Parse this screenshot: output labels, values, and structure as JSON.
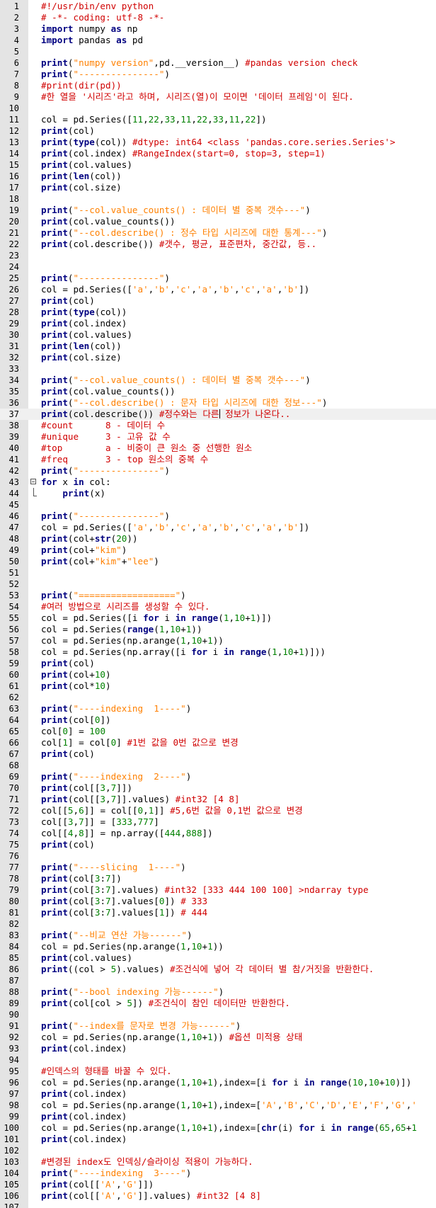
{
  "editor": {
    "current_line": 37,
    "caret_line": 37,
    "caret_column": 30,
    "fold_start_line": 43,
    "fold_end_line": 44,
    "colors": {
      "gutter": "#e4e4e4",
      "keyword": "#000080",
      "string": "#ff8000",
      "number": "#008000",
      "comment": "#d00000"
    },
    "keywords": [
      "import",
      "as",
      "for",
      "in"
    ],
    "builtins": [
      "print",
      "type",
      "len",
      "str",
      "range",
      "chr"
    ],
    "lines": [
      "#!/usr/bin/env python",
      "# -*- coding: utf-8 -*-",
      "import numpy as np",
      "import pandas as pd",
      "",
      "print(\"numpy version\",pd.__version__) #pandas version check",
      "print(\"---------------\")",
      "#print(dir(pd))",
      "#한 열을 '시리즈'라고 하며, 시리즈(열)이 모이면 '데이터 프레임'이 된다.",
      "",
      "col = pd.Series([11,22,33,11,22,33,11,22])",
      "print(col)",
      "print(type(col)) #dtype: int64 <class 'pandas.core.series.Series'>",
      "print(col.index) #RangeIndex(start=0, stop=3, step=1)",
      "print(col.values)",
      "print(len(col))",
      "print(col.size)",
      "",
      "print(\"--col.value_counts() : 데이터 별 중복 갯수---\")",
      "print(col.value_counts())",
      "print(\"--col.describe() : 정수 타입 시리즈에 대한 통계---\")",
      "print(col.describe()) #갯수, 평균, 표준편차, 중간값, 등..",
      "",
      "",
      "print(\"---------------\")",
      "col = pd.Series(['a','b','c','a','b','c','a','b'])",
      "print(col)",
      "print(type(col))",
      "print(col.index)",
      "print(col.values)",
      "print(len(col))",
      "print(col.size)",
      "",
      "print(\"--col.value_counts() : 데이터 별 중복 갯수---\")",
      "print(col.value_counts())",
      "print(\"--col.describe() : 문자 타입 시리즈에 대한 정보---\")",
      "print(col.describe()) #정수와는 다른 정보가 나온다..",
      "#count      8 - 데이터 수",
      "#unique     3 - 고유 값 수",
      "#top        a - 비중이 큰 원소 중 선행한 원소",
      "#freq       3 - top 원소의 중복 수",
      "print(\"---------------\")",
      "for x in col:",
      "    print(x)",
      "",
      "print(\"---------------\")",
      "col = pd.Series(['a','b','c','a','b','c','a','b'])",
      "print(col+str(20))",
      "print(col+\"kim\")",
      "print(col+\"kim\"+\"lee\")",
      "",
      "",
      "print(\"==================\")",
      "#여러 방법으로 시리즈를 생성할 수 있다.",
      "col = pd.Series([i for i in range(1,10+1)])",
      "col = pd.Series(range(1,10+1))",
      "col = pd.Series(np.arange(1,10+1))",
      "col = pd.Series(np.array([i for i in range(1,10+1)]))",
      "print(col)",
      "print(col+10)",
      "print(col*10)",
      "",
      "print(\"----indexing  1----\")",
      "print(col[0])",
      "col[0] = 100",
      "col[1] = col[0] #1번 값을 0번 값으로 변경",
      "print(col)",
      "",
      "print(\"----indexing  2----\")",
      "print(col[[3,7]])",
      "print(col[[3,7]].values) #int32 [4 8]",
      "col[[5,6]] = col[[0,1]] #5,6번 값을 0,1번 값으로 변경",
      "col[[3,7]] = [333,777]",
      "col[[4,8]] = np.array([444,888])",
      "print(col)",
      "",
      "print(\"----slicing  1----\")",
      "print(col[3:7])",
      "print(col[3:7].values) #int32 [333 444 100 100] >ndarray type",
      "print(col[3:7].values[0]) # 333",
      "print(col[3:7].values[1]) # 444",
      "",
      "print(\"--비교 연산 가능------\")",
      "col = pd.Series(np.arange(1,10+1))",
      "print(col.values)",
      "print((col > 5).values) #조건식에 넣어 각 데이터 별 참/거짓을 반환한다.",
      "",
      "print(\"--bool indexing 가능------\")",
      "print(col[col > 5]) #조건식이 참인 데이터만 반환한다.",
      "",
      "print(\"--index를 문자로 변경 가능------\")",
      "col = pd.Series(np.arange(1,10+1)) #옵션 미적용 상태",
      "print(col.index)",
      "",
      "#인덱스의 형태를 바꿀 수 있다.",
      "col = pd.Series(np.arange(1,10+1),index=[i for i in range(10,10+10)])",
      "print(col.index)",
      "col = pd.Series(np.arange(1,10+1),index=['A','B','C','D','E','F','G','",
      "print(col.index)",
      "col = pd.Series(np.arange(1,10+1),index=[chr(i) for i in range(65,65+1",
      "print(col.index)",
      "",
      "#변경된 index도 인덱싱/슬라이싱 적용이 가능하다.",
      "print(\"----indexing  3----\")",
      "print(col[['A','G']])",
      "print(col[['A','G']].values) #int32 [4 8]",
      ""
    ]
  }
}
